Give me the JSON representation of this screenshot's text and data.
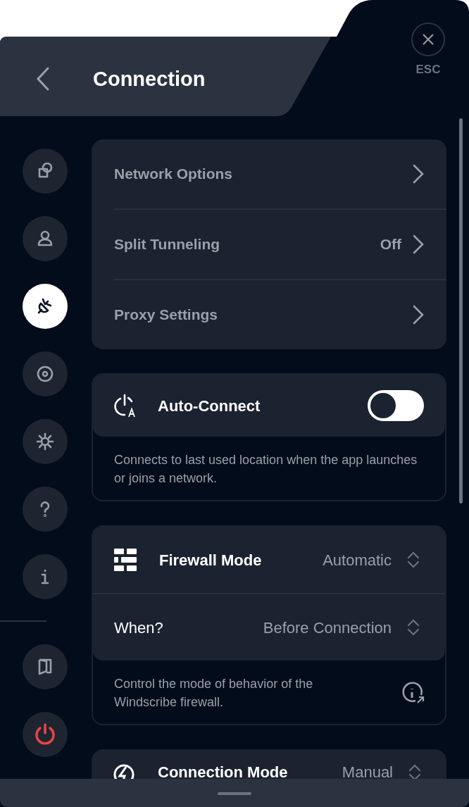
{
  "header": {
    "title": "Connection",
    "close_label": "ESC"
  },
  "sidebar": {
    "items": [
      {
        "selected": false
      },
      {
        "selected": false
      },
      {
        "selected": true
      },
      {
        "selected": false
      },
      {
        "selected": false
      },
      {
        "selected": false
      },
      {
        "selected": false
      }
    ]
  },
  "menu": [
    {
      "label": "Network Options"
    },
    {
      "label": "Split Tunneling",
      "value": "Off"
    },
    {
      "label": "Proxy Settings"
    }
  ],
  "auto_connect": {
    "title": "Auto-Connect",
    "on": false,
    "description": "Connects to last used location when the app launches or joins a network."
  },
  "firewall": {
    "title": "Firewall Mode",
    "value": "Automatic",
    "when_label": "When?",
    "when_value": "Before Connection",
    "description": "Control the mode of behavior of the Windscribe firewall."
  },
  "connection_mode": {
    "title": "Connection Mode",
    "value": "Manual"
  }
}
